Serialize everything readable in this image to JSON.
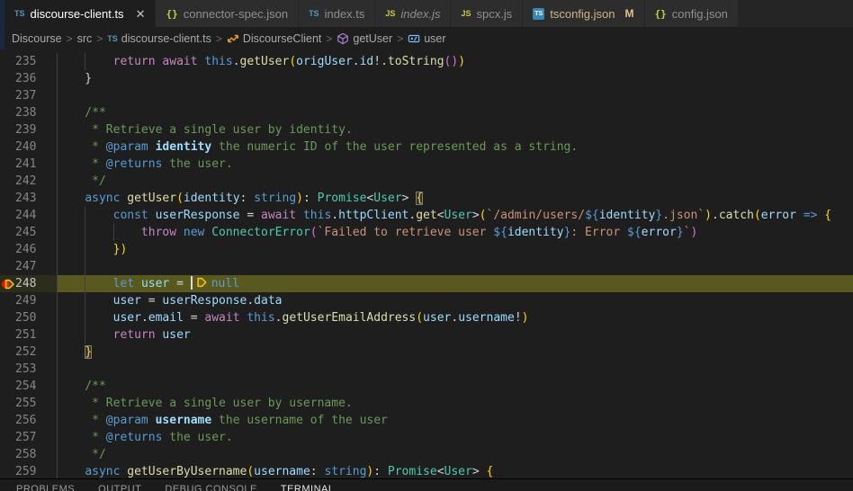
{
  "colors": {
    "editor_bg": "#1e1e1e",
    "tabbar_bg": "#252526",
    "inactive_tab_bg": "#2d2d2d",
    "line_highlight": "#4f4d1c",
    "breakpoint_red": "#e51400",
    "debug_arrow_yellow": "#ffcc00",
    "keyword_blue": "#569CD6",
    "control_pink": "#C586C0",
    "function_yellow": "#DCDCAA",
    "variable_blue": "#9CDCFE",
    "type_teal": "#4EC9B0",
    "string_orange": "#CE9178",
    "comment_green": "#6A9955",
    "git_modified": "#E2C08D"
  },
  "tabs": [
    {
      "label": "discourse-client.ts",
      "icon": "ts",
      "active": true,
      "close": "✕"
    },
    {
      "label": "connector-spec.json",
      "icon": "braces"
    },
    {
      "label": "index.ts",
      "icon": "ts"
    },
    {
      "label": "index.js",
      "icon": "js",
      "italic": true
    },
    {
      "label": "spcx.js",
      "icon": "js"
    },
    {
      "label": "tsconfig.json",
      "icon": "tsconfig",
      "git": "M"
    },
    {
      "label": "config.json",
      "icon": "braces"
    }
  ],
  "breadcrumb": {
    "separator": ">",
    "items": [
      {
        "label": "Discourse"
      },
      {
        "label": "src"
      },
      {
        "label": "discourse-client.ts",
        "icon": "ts"
      },
      {
        "label": "DiscourseClient",
        "icon": "class"
      },
      {
        "label": "getUser",
        "icon": "method"
      },
      {
        "label": "user",
        "icon": "variable"
      }
    ]
  },
  "editor": {
    "lines": [
      {
        "num": 235,
        "guides": [
          0,
          4
        ],
        "tokens": [
          [
            "d",
            "        "
          ],
          [
            "c",
            "return"
          ],
          [
            "d",
            " "
          ],
          [
            "c",
            "await"
          ],
          [
            "d",
            " "
          ],
          [
            "k",
            "this"
          ],
          [
            "d",
            "."
          ],
          [
            "f",
            "getUser"
          ],
          [
            "g1",
            "("
          ],
          [
            "v",
            "origUser"
          ],
          [
            "d",
            "."
          ],
          [
            "v",
            "id"
          ],
          [
            "d",
            "!."
          ],
          [
            "f",
            "toString"
          ],
          [
            "g2",
            "()"
          ],
          [
            "g1",
            ")"
          ]
        ]
      },
      {
        "num": 236,
        "guides": [
          0
        ],
        "tokens": [
          [
            "d",
            "    }"
          ]
        ]
      },
      {
        "num": 237,
        "guides": [
          0
        ],
        "tokens": []
      },
      {
        "num": 238,
        "guides": [
          0
        ],
        "tokens": [
          [
            "m",
            "    /**"
          ]
        ]
      },
      {
        "num": 239,
        "guides": [
          0
        ],
        "tokens": [
          [
            "m",
            "     * Retrieve a single user by identity."
          ]
        ]
      },
      {
        "num": 240,
        "guides": [
          0
        ],
        "tokens": [
          [
            "m",
            "     * "
          ],
          [
            "jk",
            "@param"
          ],
          [
            "m",
            " "
          ],
          [
            "jv",
            "identity"
          ],
          [
            "m",
            " the numeric ID of the user represented as a string."
          ]
        ]
      },
      {
        "num": 241,
        "guides": [
          0
        ],
        "tokens": [
          [
            "m",
            "     * "
          ],
          [
            "jk",
            "@returns"
          ],
          [
            "m",
            " the user."
          ]
        ]
      },
      {
        "num": 242,
        "guides": [
          0
        ],
        "tokens": [
          [
            "m",
            "     */"
          ]
        ]
      },
      {
        "num": 243,
        "guides": [
          0
        ],
        "tokens": [
          [
            "d",
            "    "
          ],
          [
            "k",
            "async"
          ],
          [
            "d",
            " "
          ],
          [
            "f",
            "getUser"
          ],
          [
            "g1",
            "("
          ],
          [
            "v",
            "identity"
          ],
          [
            "d",
            ": "
          ],
          [
            "k",
            "string"
          ],
          [
            "g1",
            ")"
          ],
          [
            "d",
            ": "
          ],
          [
            "t",
            "Promise"
          ],
          [
            "d",
            "<"
          ],
          [
            "t",
            "User"
          ],
          [
            "d",
            "> "
          ],
          [
            "g1 bm",
            "{"
          ]
        ]
      },
      {
        "num": 244,
        "guides": [
          0,
          4
        ],
        "tokens": [
          [
            "d",
            "        "
          ],
          [
            "k",
            "const"
          ],
          [
            "d",
            " "
          ],
          [
            "v",
            "userResponse"
          ],
          [
            "d",
            " = "
          ],
          [
            "c",
            "await"
          ],
          [
            "d",
            " "
          ],
          [
            "k",
            "this"
          ],
          [
            "d",
            "."
          ],
          [
            "v",
            "httpClient"
          ],
          [
            "d",
            "."
          ],
          [
            "f",
            "get"
          ],
          [
            "d",
            "<"
          ],
          [
            "t",
            "User"
          ],
          [
            "d",
            ">"
          ],
          [
            "g1",
            "("
          ],
          [
            "s",
            "`/admin/users/"
          ],
          [
            "tb",
            "${"
          ],
          [
            "v",
            "identity"
          ],
          [
            "tb",
            "}"
          ],
          [
            "s",
            ".json`"
          ],
          [
            "g1",
            ")"
          ],
          [
            "d",
            "."
          ],
          [
            "f",
            "catch"
          ],
          [
            "g1",
            "("
          ],
          [
            "v",
            "error"
          ],
          [
            "d",
            " "
          ],
          [
            "k",
            "=>"
          ],
          [
            "d",
            " "
          ],
          [
            "g1",
            "{"
          ]
        ]
      },
      {
        "num": 245,
        "guides": [
          0,
          4,
          8
        ],
        "tokens": [
          [
            "d",
            "            "
          ],
          [
            "c",
            "throw"
          ],
          [
            "d",
            " "
          ],
          [
            "k",
            "new"
          ],
          [
            "d",
            " "
          ],
          [
            "t",
            "ConnectorError"
          ],
          [
            "g2",
            "("
          ],
          [
            "s",
            "`Failed to retrieve user "
          ],
          [
            "tb",
            "${"
          ],
          [
            "v",
            "identity"
          ],
          [
            "tb",
            "}"
          ],
          [
            "s",
            ": Error "
          ],
          [
            "tb",
            "${"
          ],
          [
            "v",
            "error"
          ],
          [
            "tb",
            "}"
          ],
          [
            "s",
            "`"
          ],
          [
            "g2",
            ")"
          ]
        ]
      },
      {
        "num": 246,
        "guides": [
          0,
          4
        ],
        "tokens": [
          [
            "d",
            "        "
          ],
          [
            "g1",
            "})"
          ]
        ]
      },
      {
        "num": 247,
        "guides": [
          0,
          4
        ],
        "tokens": []
      },
      {
        "num": 248,
        "guides": [
          0,
          4
        ],
        "highlight": true,
        "debug_gutter": true,
        "tokens": [
          [
            "d",
            "        "
          ],
          [
            "k",
            "let"
          ],
          [
            "d",
            " "
          ],
          [
            "v",
            "user"
          ],
          [
            "d",
            " = "
          ],
          [
            "caret",
            ""
          ],
          [
            "bulb",
            ""
          ],
          [
            "k",
            "null"
          ]
        ]
      },
      {
        "num": 249,
        "guides": [
          0,
          4
        ],
        "tokens": [
          [
            "d",
            "        "
          ],
          [
            "v",
            "user"
          ],
          [
            "d",
            " = "
          ],
          [
            "v",
            "userResponse"
          ],
          [
            "d",
            "."
          ],
          [
            "v",
            "data"
          ]
        ]
      },
      {
        "num": 250,
        "guides": [
          0,
          4
        ],
        "tokens": [
          [
            "d",
            "        "
          ],
          [
            "v",
            "user"
          ],
          [
            "d",
            "."
          ],
          [
            "v",
            "email"
          ],
          [
            "d",
            " = "
          ],
          [
            "c",
            "await"
          ],
          [
            "d",
            " "
          ],
          [
            "k",
            "this"
          ],
          [
            "d",
            "."
          ],
          [
            "f",
            "getUserEmailAddress"
          ],
          [
            "g1",
            "("
          ],
          [
            "v",
            "user"
          ],
          [
            "d",
            "."
          ],
          [
            "v",
            "username"
          ],
          [
            "d",
            "!"
          ],
          [
            "g1",
            ")"
          ]
        ]
      },
      {
        "num": 251,
        "guides": [
          0,
          4
        ],
        "tokens": [
          [
            "d",
            "        "
          ],
          [
            "c",
            "return"
          ],
          [
            "d",
            " "
          ],
          [
            "v",
            "user"
          ]
        ]
      },
      {
        "num": 252,
        "guides": [
          0
        ],
        "tokens": [
          [
            "d",
            "    "
          ],
          [
            "g1 bm",
            "}"
          ]
        ]
      },
      {
        "num": 253,
        "guides": [
          0
        ],
        "tokens": []
      },
      {
        "num": 254,
        "guides": [
          0
        ],
        "tokens": [
          [
            "m",
            "    /**"
          ]
        ]
      },
      {
        "num": 255,
        "guides": [
          0
        ],
        "tokens": [
          [
            "m",
            "     * Retrieve a single user by username."
          ]
        ]
      },
      {
        "num": 256,
        "guides": [
          0
        ],
        "tokens": [
          [
            "m",
            "     * "
          ],
          [
            "jk",
            "@param"
          ],
          [
            "m",
            " "
          ],
          [
            "jv",
            "username"
          ],
          [
            "m",
            " the username of the user"
          ]
        ]
      },
      {
        "num": 257,
        "guides": [
          0
        ],
        "tokens": [
          [
            "m",
            "     * "
          ],
          [
            "jk",
            "@returns"
          ],
          [
            "m",
            " the user."
          ]
        ]
      },
      {
        "num": 258,
        "guides": [
          0
        ],
        "tokens": [
          [
            "m",
            "     */"
          ]
        ]
      },
      {
        "num": 259,
        "guides": [
          0
        ],
        "tokens": [
          [
            "d",
            "    "
          ],
          [
            "k",
            "async"
          ],
          [
            "d",
            " "
          ],
          [
            "f",
            "getUserByUsername"
          ],
          [
            "g1",
            "("
          ],
          [
            "v",
            "username"
          ],
          [
            "d",
            ": "
          ],
          [
            "k",
            "string"
          ],
          [
            "g1",
            ")"
          ],
          [
            "d",
            ": "
          ],
          [
            "t",
            "Promise"
          ],
          [
            "d",
            "<"
          ],
          [
            "t",
            "User"
          ],
          [
            "d",
            "> "
          ],
          [
            "g1",
            "{"
          ]
        ]
      }
    ]
  },
  "panel": {
    "tabs": [
      {
        "label": "PROBLEMS"
      },
      {
        "label": "OUTPUT"
      },
      {
        "label": "DEBUG CONSOLE"
      },
      {
        "label": "TERMINAL",
        "active": true
      }
    ]
  }
}
